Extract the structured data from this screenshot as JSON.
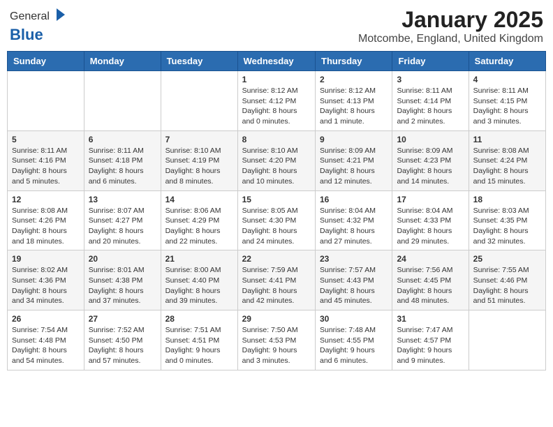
{
  "header": {
    "logo_general": "General",
    "logo_blue": "Blue",
    "month_title": "January 2025",
    "location": "Motcombe, England, United Kingdom"
  },
  "days_of_week": [
    "Sunday",
    "Monday",
    "Tuesday",
    "Wednesday",
    "Thursday",
    "Friday",
    "Saturday"
  ],
  "weeks": [
    [
      {
        "day": "",
        "info": ""
      },
      {
        "day": "",
        "info": ""
      },
      {
        "day": "",
        "info": ""
      },
      {
        "day": "1",
        "info": "Sunrise: 8:12 AM\nSunset: 4:12 PM\nDaylight: 8 hours and 0 minutes."
      },
      {
        "day": "2",
        "info": "Sunrise: 8:12 AM\nSunset: 4:13 PM\nDaylight: 8 hours and 1 minute."
      },
      {
        "day": "3",
        "info": "Sunrise: 8:11 AM\nSunset: 4:14 PM\nDaylight: 8 hours and 2 minutes."
      },
      {
        "day": "4",
        "info": "Sunrise: 8:11 AM\nSunset: 4:15 PM\nDaylight: 8 hours and 3 minutes."
      }
    ],
    [
      {
        "day": "5",
        "info": "Sunrise: 8:11 AM\nSunset: 4:16 PM\nDaylight: 8 hours and 5 minutes."
      },
      {
        "day": "6",
        "info": "Sunrise: 8:11 AM\nSunset: 4:18 PM\nDaylight: 8 hours and 6 minutes."
      },
      {
        "day": "7",
        "info": "Sunrise: 8:10 AM\nSunset: 4:19 PM\nDaylight: 8 hours and 8 minutes."
      },
      {
        "day": "8",
        "info": "Sunrise: 8:10 AM\nSunset: 4:20 PM\nDaylight: 8 hours and 10 minutes."
      },
      {
        "day": "9",
        "info": "Sunrise: 8:09 AM\nSunset: 4:21 PM\nDaylight: 8 hours and 12 minutes."
      },
      {
        "day": "10",
        "info": "Sunrise: 8:09 AM\nSunset: 4:23 PM\nDaylight: 8 hours and 14 minutes."
      },
      {
        "day": "11",
        "info": "Sunrise: 8:08 AM\nSunset: 4:24 PM\nDaylight: 8 hours and 15 minutes."
      }
    ],
    [
      {
        "day": "12",
        "info": "Sunrise: 8:08 AM\nSunset: 4:26 PM\nDaylight: 8 hours and 18 minutes."
      },
      {
        "day": "13",
        "info": "Sunrise: 8:07 AM\nSunset: 4:27 PM\nDaylight: 8 hours and 20 minutes."
      },
      {
        "day": "14",
        "info": "Sunrise: 8:06 AM\nSunset: 4:29 PM\nDaylight: 8 hours and 22 minutes."
      },
      {
        "day": "15",
        "info": "Sunrise: 8:05 AM\nSunset: 4:30 PM\nDaylight: 8 hours and 24 minutes."
      },
      {
        "day": "16",
        "info": "Sunrise: 8:04 AM\nSunset: 4:32 PM\nDaylight: 8 hours and 27 minutes."
      },
      {
        "day": "17",
        "info": "Sunrise: 8:04 AM\nSunset: 4:33 PM\nDaylight: 8 hours and 29 minutes."
      },
      {
        "day": "18",
        "info": "Sunrise: 8:03 AM\nSunset: 4:35 PM\nDaylight: 8 hours and 32 minutes."
      }
    ],
    [
      {
        "day": "19",
        "info": "Sunrise: 8:02 AM\nSunset: 4:36 PM\nDaylight: 8 hours and 34 minutes."
      },
      {
        "day": "20",
        "info": "Sunrise: 8:01 AM\nSunset: 4:38 PM\nDaylight: 8 hours and 37 minutes."
      },
      {
        "day": "21",
        "info": "Sunrise: 8:00 AM\nSunset: 4:40 PM\nDaylight: 8 hours and 39 minutes."
      },
      {
        "day": "22",
        "info": "Sunrise: 7:59 AM\nSunset: 4:41 PM\nDaylight: 8 hours and 42 minutes."
      },
      {
        "day": "23",
        "info": "Sunrise: 7:57 AM\nSunset: 4:43 PM\nDaylight: 8 hours and 45 minutes."
      },
      {
        "day": "24",
        "info": "Sunrise: 7:56 AM\nSunset: 4:45 PM\nDaylight: 8 hours and 48 minutes."
      },
      {
        "day": "25",
        "info": "Sunrise: 7:55 AM\nSunset: 4:46 PM\nDaylight: 8 hours and 51 minutes."
      }
    ],
    [
      {
        "day": "26",
        "info": "Sunrise: 7:54 AM\nSunset: 4:48 PM\nDaylight: 8 hours and 54 minutes."
      },
      {
        "day": "27",
        "info": "Sunrise: 7:52 AM\nSunset: 4:50 PM\nDaylight: 8 hours and 57 minutes."
      },
      {
        "day": "28",
        "info": "Sunrise: 7:51 AM\nSunset: 4:51 PM\nDaylight: 9 hours and 0 minutes."
      },
      {
        "day": "29",
        "info": "Sunrise: 7:50 AM\nSunset: 4:53 PM\nDaylight: 9 hours and 3 minutes."
      },
      {
        "day": "30",
        "info": "Sunrise: 7:48 AM\nSunset: 4:55 PM\nDaylight: 9 hours and 6 minutes."
      },
      {
        "day": "31",
        "info": "Sunrise: 7:47 AM\nSunset: 4:57 PM\nDaylight: 9 hours and 9 minutes."
      },
      {
        "day": "",
        "info": ""
      }
    ]
  ]
}
